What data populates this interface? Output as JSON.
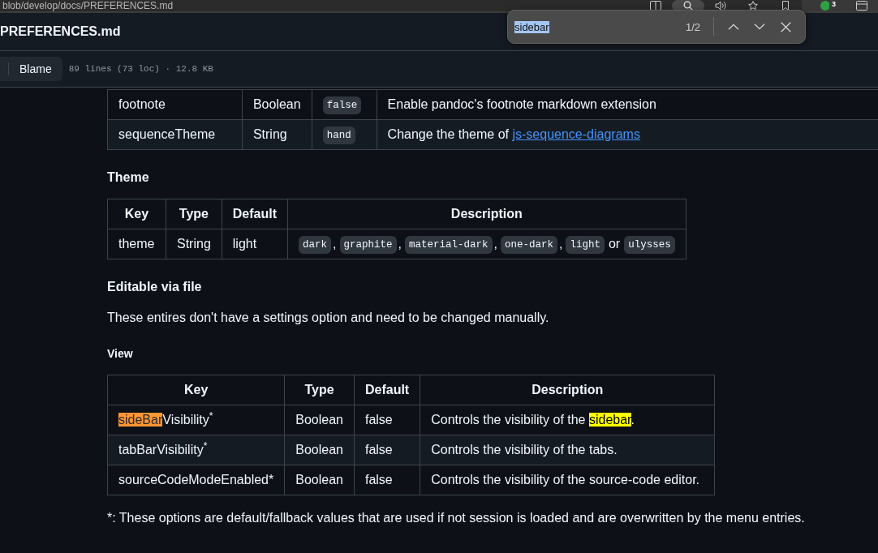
{
  "browser": {
    "address": "blob/develop/docs/PREFERENCES.md",
    "toolbar": [
      {
        "selected": false
      },
      {
        "selected": true
      },
      {
        "selected": false
      },
      {
        "selected": false
      },
      {
        "selected": false
      },
      {
        "selected": false,
        "badge": "3"
      },
      {
        "selected": false
      }
    ]
  },
  "find_bar": {
    "query": "sidebar",
    "query_selected": true,
    "count": "1/2"
  },
  "file_header": {
    "title": "PREFERENCES.md",
    "view_tabs": [
      {
        "label": "Blame",
        "selected": false
      }
    ],
    "meta": "89 lines (73 loc) · 12.8 KB"
  },
  "content": [
    {
      "kind": "table",
      "rows": [
        [
          {
            "kind": "text",
            "text": "footnote"
          },
          {
            "kind": "text",
            "text": "Boolean"
          },
          {
            "kind": "code",
            "text": "false"
          },
          {
            "kind": "text",
            "text": "Enable pandoc's footnote markdown extension"
          }
        ],
        [
          {
            "kind": "text",
            "text": "sequenceTheme"
          },
          {
            "kind": "text",
            "text": "String"
          },
          {
            "kind": "code",
            "text": "hand"
          },
          {
            "kind": "link",
            "text": "Change the theme of ",
            "link": "js-sequence-diagrams"
          }
        ]
      ]
    },
    {
      "kind": "h4",
      "text": "Theme"
    },
    {
      "kind": "table",
      "columns": [
        "Key",
        "Type",
        "Default",
        "Description"
      ],
      "rows": [
        [
          {
            "kind": "text",
            "text": "theme"
          },
          {
            "kind": "text",
            "text": "String"
          },
          {
            "kind": "text",
            "text": "light"
          },
          {
            "kind": "code_list",
            "parts": [
              {
                "kind": "code",
                "text": "dark"
              },
              {
                "kind": "punct",
                "text": ","
              },
              {
                "kind": "code",
                "text": "graphite"
              },
              {
                "kind": "punct",
                "text": ","
              },
              {
                "kind": "code",
                "text": "material-dark"
              },
              {
                "kind": "punct",
                "text": ","
              },
              {
                "kind": "code",
                "text": "one-dark"
              },
              {
                "kind": "punct",
                "text": ","
              },
              {
                "kind": "code",
                "text": "light"
              },
              {
                "kind": "word",
                "text": "or"
              },
              {
                "kind": "code",
                "text": "ulysses"
              }
            ]
          }
        ]
      ]
    },
    {
      "kind": "h4",
      "text": "Editable via file"
    },
    {
      "kind": "paragraph",
      "text": "These entires don't have a settings option and need to be changed manually."
    },
    {
      "kind": "h5",
      "text": "View"
    },
    {
      "kind": "table",
      "columns": [
        "Key",
        "Type",
        "Default",
        "Description"
      ],
      "rows": [
        [
          {
            "kind": "marked",
            "segments": [
              {
                "text": "sideBar",
                "highlighted": true,
                "current": true
              },
              {
                "text": "Visibility$^{*}$",
                "highlighted": false
              }
            ]
          },
          {
            "kind": "text",
            "text": "Boolean"
          },
          {
            "kind": "text",
            "text": "false"
          },
          {
            "kind": "marked",
            "segments": [
              {
                "text": "Controls the visibility of the ",
                "highlighted": false
              },
              {
                "text": "sidebar",
                "highlighted": true,
                "current": false
              },
              {
                "text": ".",
                "highlighted": false
              }
            ]
          }
        ],
        [
          {
            "kind": "text",
            "text": "tabBarVisibility$^{*}$"
          },
          {
            "kind": "text",
            "text": "Boolean"
          },
          {
            "kind": "text",
            "text": "false"
          },
          {
            "kind": "text",
            "text": "Controls the visibility of the tabs."
          }
        ],
        [
          {
            "kind": "text",
            "text": "sourceCodeModeEnabled*"
          },
          {
            "kind": "text",
            "text": "Boolean"
          },
          {
            "kind": "text",
            "text": "false"
          },
          {
            "kind": "text",
            "text": "Controls the visibility of the source-code editor."
          }
        ]
      ]
    },
    {
      "kind": "paragraph",
      "text": "*: These options are default/fallback values that are used if not session is loaded and are overwritten by the menu entries."
    }
  ]
}
